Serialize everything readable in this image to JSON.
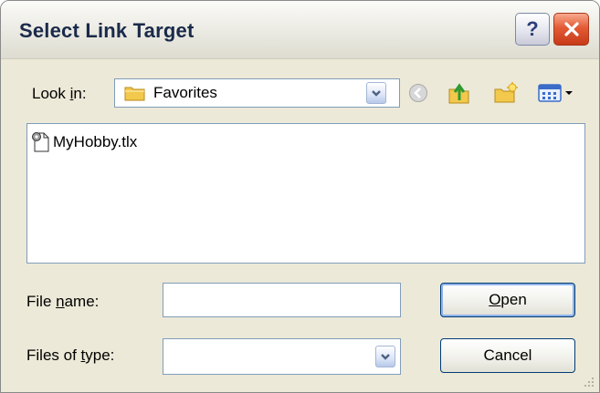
{
  "window": {
    "title": "Select Link Target"
  },
  "title_buttons": {
    "help": "?"
  },
  "look_in": {
    "prefix": "Look ",
    "accel": "i",
    "suffix": "n:",
    "value": "Favorites"
  },
  "files": [
    {
      "name": "MyHobby.tlx"
    }
  ],
  "file_name": {
    "prefix": "File ",
    "accel": "n",
    "suffix": "ame:",
    "value": ""
  },
  "file_type": {
    "prefix": "Files of ",
    "accel": "t",
    "suffix": "ype:",
    "value": ""
  },
  "buttons": {
    "open_accel": "O",
    "open_rest": "pen",
    "cancel": "Cancel"
  },
  "colors": {
    "accent": "#003c74",
    "field_border": "#7f9db9",
    "close": "#e35b35",
    "folder": "#f2c94c"
  }
}
